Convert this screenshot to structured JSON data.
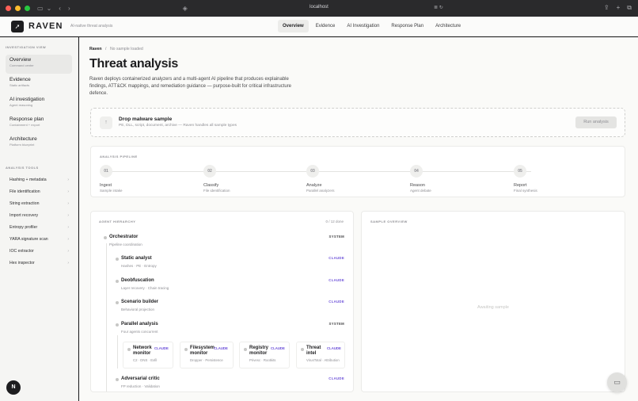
{
  "browser": {
    "url": "localhost"
  },
  "app": {
    "name": "RAVEN",
    "tagline": "AI-native threat analysis"
  },
  "nav": [
    "Overview",
    "Evidence",
    "AI Investigation",
    "Response Plan",
    "Architecture"
  ],
  "sidebar": {
    "view_heading": "INVESTIGATION VIEW",
    "views": [
      {
        "title": "Overview",
        "sub": "Command center"
      },
      {
        "title": "Evidence",
        "sub": "Static artifacts"
      },
      {
        "title": "AI investigation",
        "sub": "Agent reasoning"
      },
      {
        "title": "Response plan",
        "sub": "Containment + export"
      },
      {
        "title": "Architecture",
        "sub": "Platform blueprint"
      }
    ],
    "tools_heading": "ANALYSIS TOOLS",
    "tools": [
      "Hashing + metadata",
      "File identification",
      "String extraction",
      "Import recovery",
      "Entropy profiler",
      "YARA signature scan",
      "IOC extractor",
      "Hex inspector"
    ]
  },
  "breadcrumb": {
    "root": "Raven",
    "sep": "/",
    "current": "No sample loaded"
  },
  "page": {
    "title": "Threat analysis",
    "lead": "Raven deploys containerized analyzers and a multi-agent AI pipeline that produces explainable findings, ATT&CK mappings, and remediation guidance — purpose-built for critical infrastructure defence."
  },
  "drop": {
    "title": "Drop malware sample",
    "sub": "PE, DLL, script, document, archive — Raven handles all sample types",
    "button": "Run analysis"
  },
  "pipeline": {
    "label": "ANALYSIS PIPELINE",
    "steps": [
      {
        "num": "01",
        "name": "Ingest",
        "desc": "Sample intake"
      },
      {
        "num": "02",
        "name": "Classify",
        "desc": "File identification"
      },
      {
        "num": "03",
        "name": "Analyze",
        "desc": "Parallel analyzers"
      },
      {
        "num": "04",
        "name": "Reason",
        "desc": "Agent debate"
      },
      {
        "num": "05",
        "name": "Report",
        "desc": "Final synthesis"
      }
    ]
  },
  "agents": {
    "label": "AGENT HIERARCHY",
    "done": "0 / 12 done",
    "root": {
      "name": "Orchestrator",
      "desc": "Pipeline coordination",
      "tag": "SYSTEM"
    },
    "children": [
      {
        "name": "Static analyst",
        "desc": "Hashes · PE · Entropy",
        "tag": "CLAUDE"
      },
      {
        "name": "Deobfuscation",
        "desc": "Layer recovery · Chain tracing",
        "tag": "CLAUDE"
      },
      {
        "name": "Scenario builder",
        "desc": "Behavioral projection",
        "tag": "CLAUDE"
      },
      {
        "name": "Parallel analysis",
        "desc": "Four agents concurrent",
        "tag": "SYSTEM"
      }
    ],
    "parallel": [
      {
        "name": "Network monitor",
        "desc": "C2 · DNS · Exfil",
        "tag": "CLAUDE"
      },
      {
        "name": "Filesystem monitor",
        "desc": "Dropper · Persistence",
        "tag": "CLAUDE"
      },
      {
        "name": "Registry monitor",
        "desc": "Privesc · Rootkits",
        "tag": "CLAUDE"
      },
      {
        "name": "Threat intel",
        "desc": "VirusTotal · Attribution",
        "tag": "CLAUDE"
      }
    ],
    "last": {
      "name": "Adversarial critic",
      "desc": "FP reduction · Validation",
      "tag": "CLAUDE"
    }
  },
  "overview": {
    "label": "SAMPLE OVERVIEW",
    "empty": "Awaiting sample"
  },
  "fab": {
    "left": "N"
  },
  "icons": [
    "sidebar-icon",
    "chevron-down-icon",
    "back-icon",
    "forward-icon",
    "shield-icon",
    "reader-icon",
    "reload-icon",
    "share-icon",
    "new-tab-icon",
    "tabs-icon",
    "raven-logo-icon",
    "upload-arrow-icon",
    "chat-icon"
  ]
}
